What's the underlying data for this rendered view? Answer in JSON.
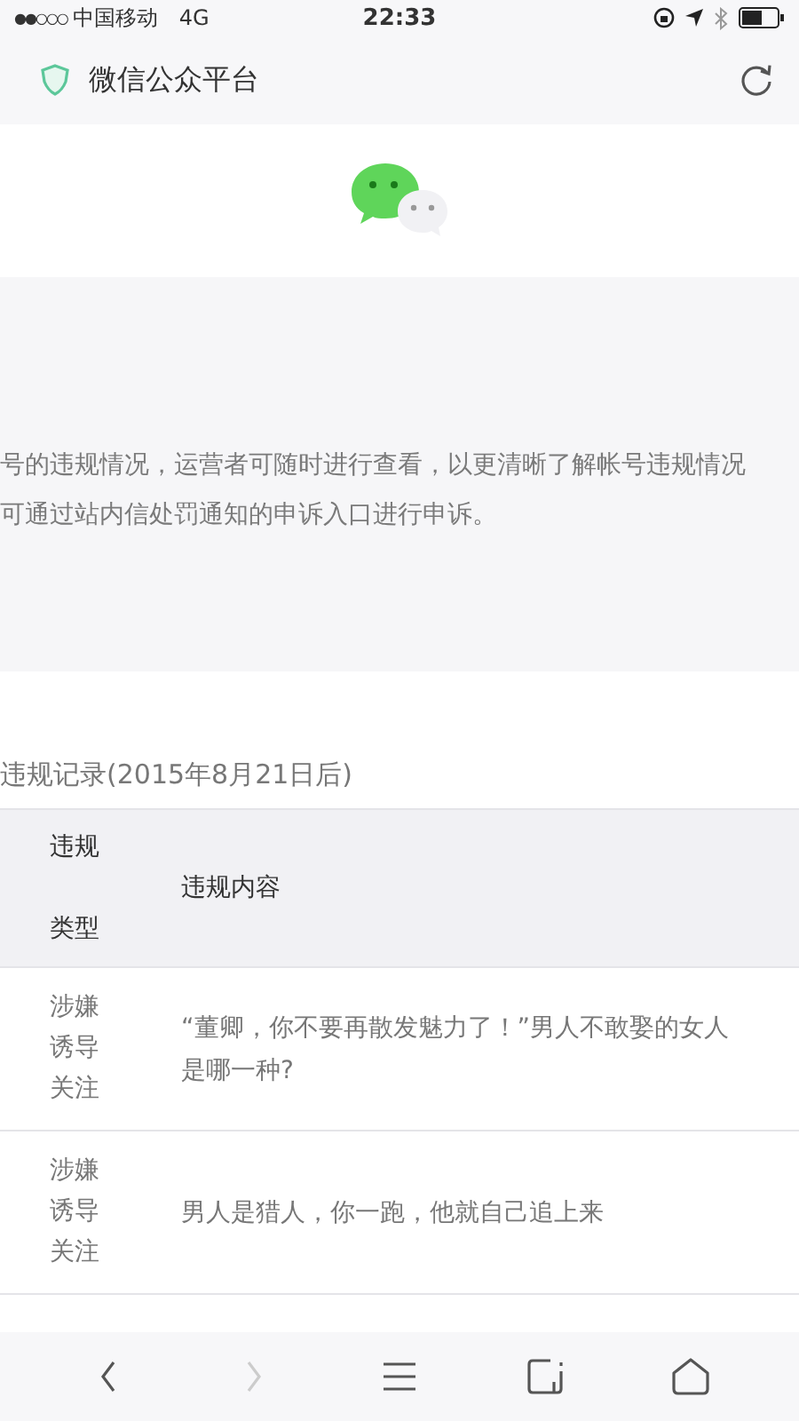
{
  "status_bar": {
    "signal": "●●○○○",
    "carrier": "中国移动",
    "network": "4G",
    "time": "22:33"
  },
  "nav_bar": {
    "title": "微信公众平台"
  },
  "notice": {
    "lines": [
      "号的违规情况，运营者可随时进行查看，以更清晰了解帐号违规情况",
      "可通过站内信处罚通知的申诉入口进行申诉。"
    ]
  },
  "records": {
    "title": "违规记录(2015年8月21日后)",
    "columns": [
      {
        "lines": [
          "违规",
          "类型"
        ]
      },
      {
        "lines": [
          "违规内容"
        ]
      }
    ],
    "rows": [
      {
        "type_lines": [
          "涉嫌",
          "诱导",
          "关注"
        ],
        "content": "“董卿，你不要再散发魅力了！”男人不敢娶的女人是哪一种?"
      },
      {
        "type_lines": [
          "涉嫌",
          "诱导",
          "关注"
        ],
        "content": "男人是猎人，你一跑，他就自己追上来"
      }
    ]
  },
  "toolbar": [
    {
      "kind": "back",
      "disabled": false
    },
    {
      "kind": "forward",
      "disabled": true
    },
    {
      "kind": "menu",
      "disabled": false
    },
    {
      "kind": "tabs",
      "disabled": false
    },
    {
      "kind": "home",
      "disabled": false
    }
  ]
}
